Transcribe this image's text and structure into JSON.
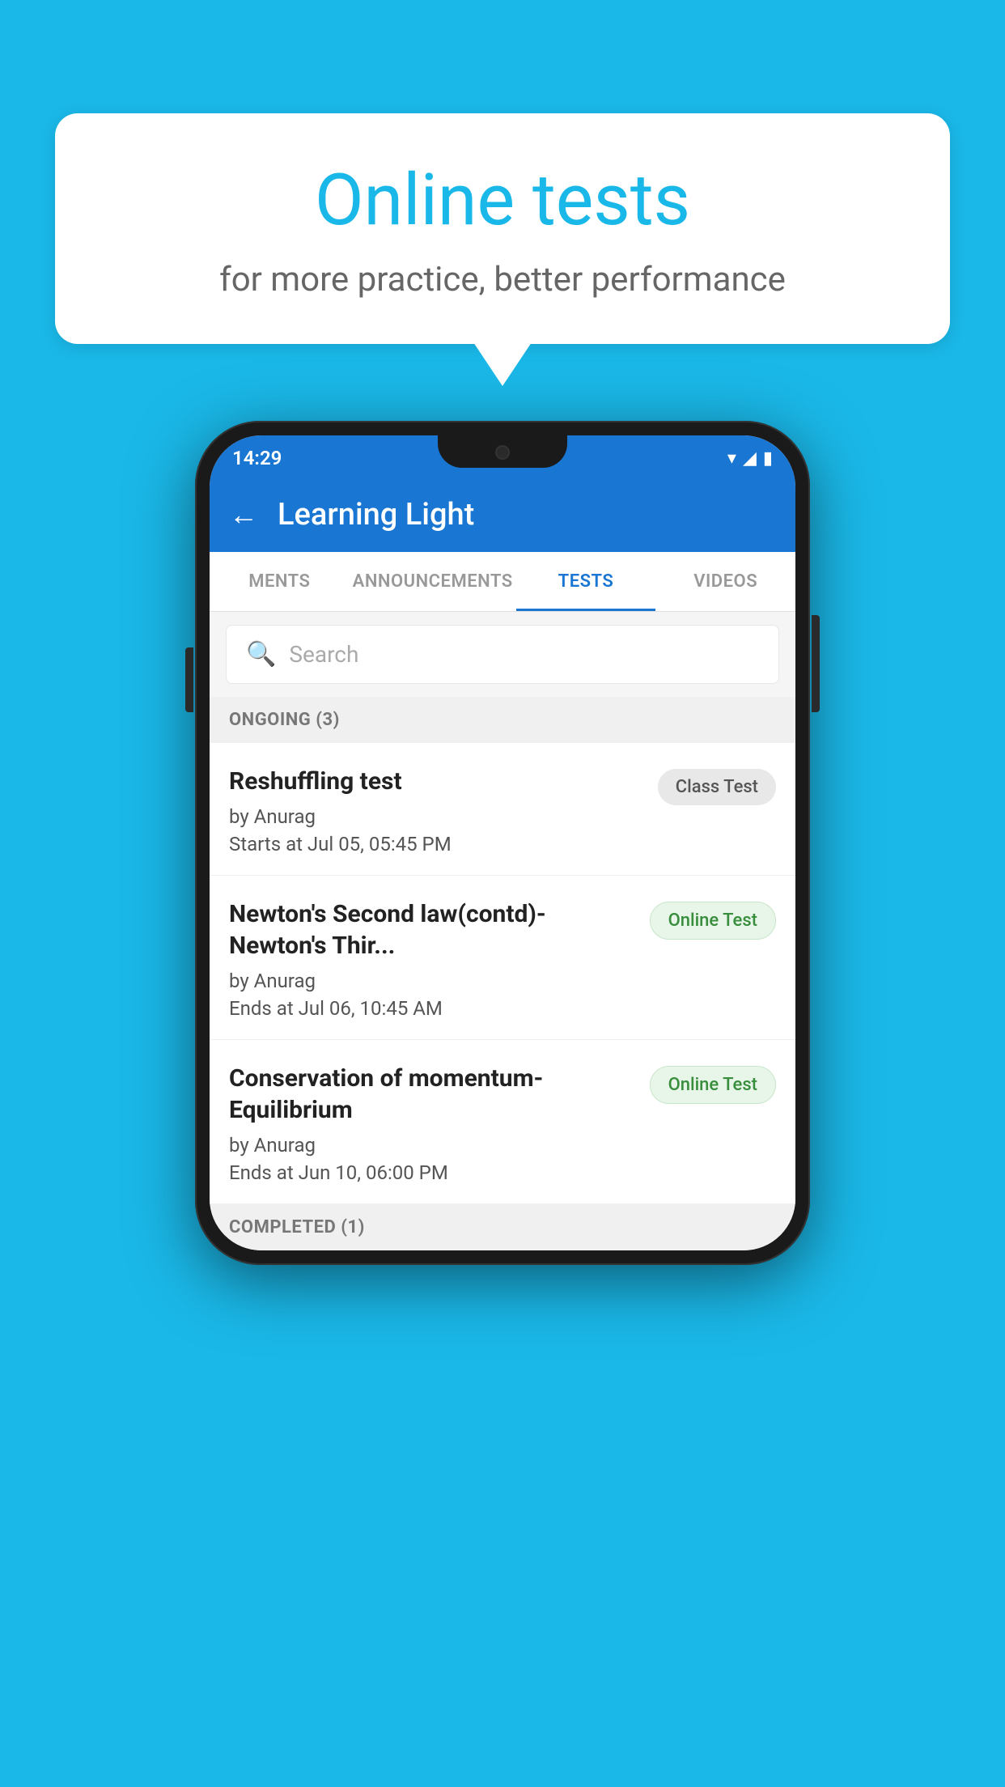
{
  "background_color": "#1ab8e8",
  "bubble": {
    "title": "Online tests",
    "subtitle": "for more practice, better performance"
  },
  "phone": {
    "status_bar": {
      "time": "14:29",
      "signal_icon": "▼",
      "network_icon": "◢",
      "battery_icon": "▮"
    },
    "app_bar": {
      "back_label": "←",
      "title": "Learning Light"
    },
    "tabs": [
      {
        "label": "MENTS",
        "active": false
      },
      {
        "label": "ANNOUNCEMENTS",
        "active": false
      },
      {
        "label": "TESTS",
        "active": true
      },
      {
        "label": "VIDEOS",
        "active": false
      }
    ],
    "search": {
      "placeholder": "Search"
    },
    "ongoing_section": {
      "label": "ONGOING (3)"
    },
    "tests": [
      {
        "title": "Reshuffling test",
        "author": "by Anurag",
        "date": "Starts at  Jul 05, 05:45 PM",
        "badge": "Class Test",
        "badge_type": "class"
      },
      {
        "title": "Newton's Second law(contd)-Newton's Thir...",
        "author": "by Anurag",
        "date": "Ends at  Jul 06, 10:45 AM",
        "badge": "Online Test",
        "badge_type": "online"
      },
      {
        "title": "Conservation of momentum-Equilibrium",
        "author": "by Anurag",
        "date": "Ends at  Jun 10, 06:00 PM",
        "badge": "Online Test",
        "badge_type": "online"
      }
    ],
    "completed_section": {
      "label": "COMPLETED (1)"
    }
  }
}
